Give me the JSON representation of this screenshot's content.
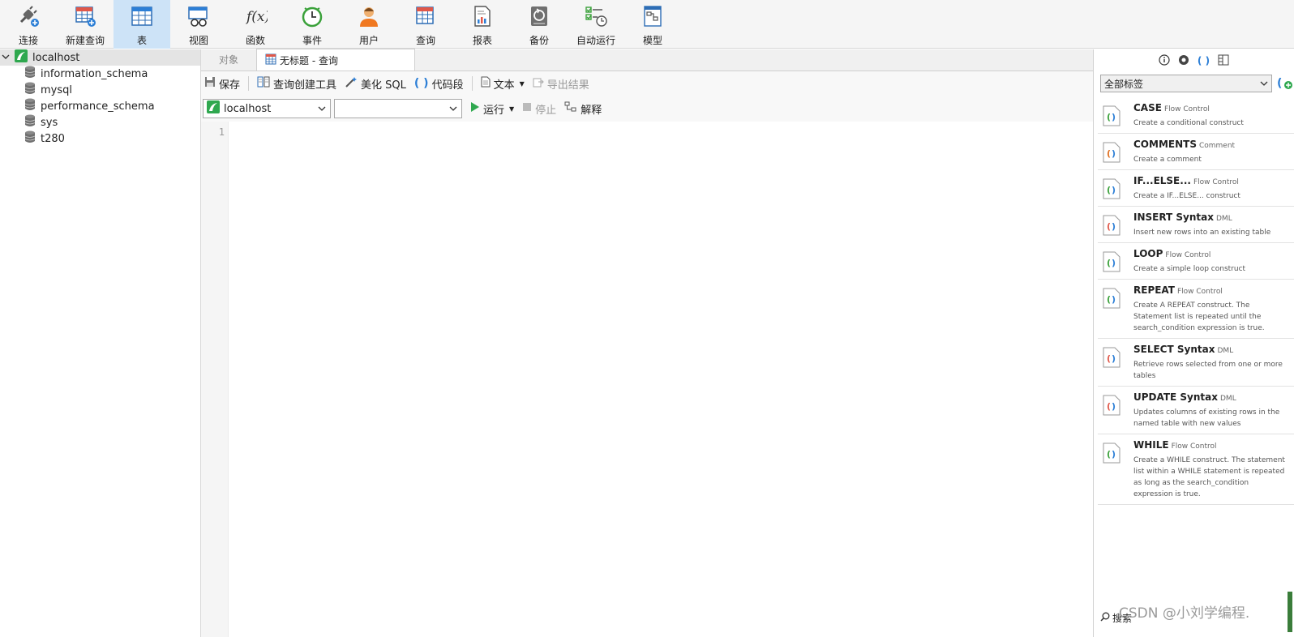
{
  "toolbar": {
    "items": [
      {
        "label": "连接",
        "icon": "plug-connect-icon"
      },
      {
        "label": "新建查询",
        "icon": "new-query-table-icon"
      },
      {
        "label": "表",
        "icon": "table-icon",
        "active": true
      },
      {
        "label": "视图",
        "icon": "view-glasses-icon"
      },
      {
        "label": "函数",
        "icon": "function-fx-icon"
      },
      {
        "label": "事件",
        "icon": "clock-event-icon"
      },
      {
        "label": "用户",
        "icon": "user-icon"
      },
      {
        "label": "查询",
        "icon": "query-table-icon"
      },
      {
        "label": "报表",
        "icon": "report-icon"
      },
      {
        "label": "备份",
        "icon": "backup-icon"
      },
      {
        "label": "自动运行",
        "icon": "checklist-schedule-icon"
      },
      {
        "label": "模型",
        "icon": "model-icon"
      }
    ],
    "active_color": "#cde3f7"
  },
  "tree": {
    "connection": "localhost",
    "databases": [
      "information_schema",
      "mysql",
      "performance_schema",
      "sys",
      "t280"
    ]
  },
  "tabs": {
    "objects": "对象",
    "query": "无标题 - 查询"
  },
  "query_toolbar": {
    "save": "保存",
    "builder": "查询创建工具",
    "beautify": "美化 SQL",
    "snippet": "代码段",
    "text": "文本",
    "export": "导出结果"
  },
  "query_selectors": {
    "connection": "localhost",
    "database": "",
    "run": "运行",
    "stop": "停止",
    "explain": "解释"
  },
  "editor": {
    "line_number": "1"
  },
  "right_panel": {
    "filter": "全部标签",
    "search": "搜索",
    "snippets": [
      {
        "name": "CASE",
        "category": "Flow Control",
        "desc": "Create a conditional construct"
      },
      {
        "name": "COMMENTS",
        "category": "Comment",
        "desc": "Create a comment"
      },
      {
        "name": "IF...ELSE...",
        "category": "Flow Control",
        "desc": "Create a IF...ELSE... construct"
      },
      {
        "name": "INSERT Syntax",
        "category": "DML",
        "desc": "Insert new rows into an existing table"
      },
      {
        "name": "LOOP",
        "category": "Flow Control",
        "desc": "Create a simple loop construct"
      },
      {
        "name": "REPEAT",
        "category": "Flow Control",
        "desc": "Create A REPEAT construct. The Statement list is repeated until the search_condition expression is true."
      },
      {
        "name": "SELECT Syntax",
        "category": "DML",
        "desc": "Retrieve rows selected from one or more tables"
      },
      {
        "name": "UPDATE Syntax",
        "category": "DML",
        "desc": "Updates columns of existing rows in the named table with new values"
      },
      {
        "name": "WHILE",
        "category": "Flow Control",
        "desc": "Create a WHILE construct. The statement list within a WHILE statement is repeated as long as the search_condition expression is true."
      }
    ]
  },
  "watermark": "CSDN @小刘学编程."
}
